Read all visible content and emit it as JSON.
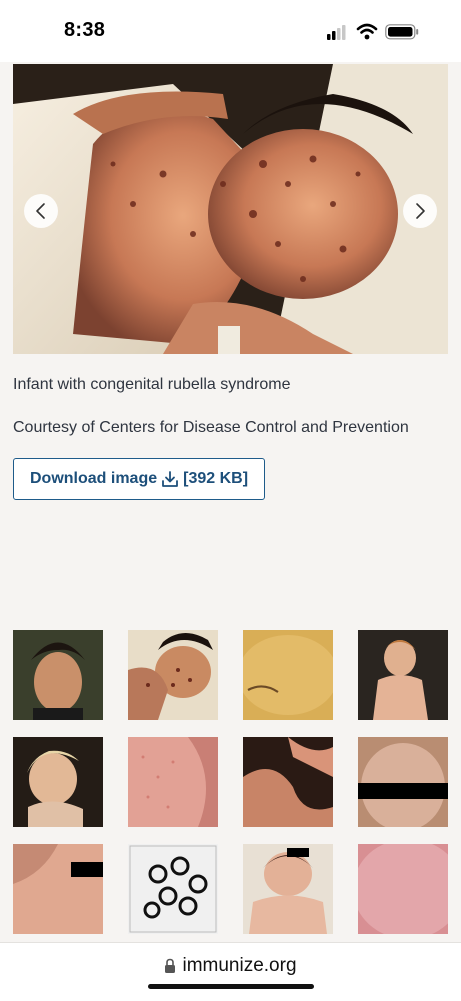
{
  "status_bar": {
    "time": "8:38"
  },
  "hero": {
    "caption": "Infant with congenital rubella syndrome",
    "credit": "Courtesy of Centers for Disease Control and Prevention"
  },
  "download": {
    "label": "Download image",
    "size": "[392 KB]"
  },
  "address_bar": {
    "url": "immunize.org"
  },
  "colors": {
    "accent": "#1d4f7a",
    "page_background": "#f6f4f2"
  },
  "icons": [
    "signal-icon",
    "wifi-icon",
    "battery-icon",
    "chevron-left-icon",
    "chevron-right-icon",
    "download-icon",
    "lock-icon"
  ]
}
